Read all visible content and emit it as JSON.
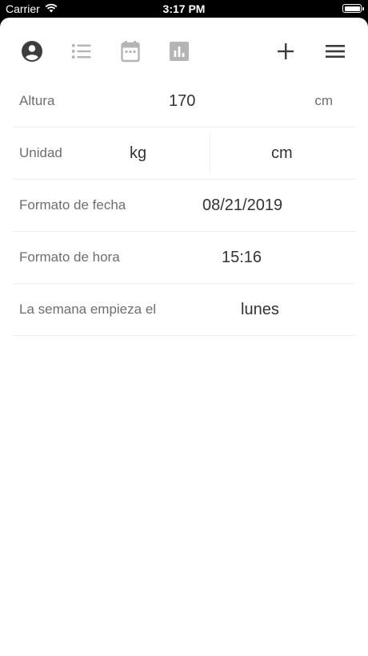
{
  "status_bar": {
    "carrier": "Carrier",
    "time": "3:17 PM"
  },
  "toolbar": {
    "icons": [
      "profile-icon",
      "list-icon",
      "calendar-icon",
      "chart-icon",
      "add-icon",
      "menu-icon"
    ],
    "active_color": "#3d3d3d",
    "inactive_color": "#b4b4b4"
  },
  "settings": {
    "height": {
      "label": "Altura",
      "value": "170",
      "unit": "cm"
    },
    "unit": {
      "label": "Unidad",
      "option_a": "kg",
      "option_b": "cm"
    },
    "date_format": {
      "label": "Formato de fecha",
      "value": "08/21/2019"
    },
    "time_format": {
      "label": "Formato de hora",
      "value": "15:16"
    },
    "week_start": {
      "label": "La semana empieza el",
      "value": "lunes"
    }
  }
}
